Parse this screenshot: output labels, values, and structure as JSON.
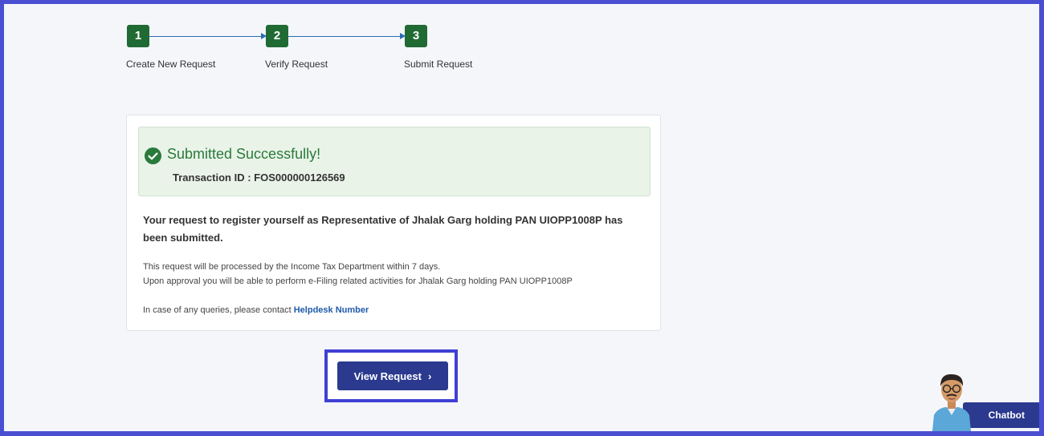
{
  "stepper": {
    "steps": [
      {
        "number": "1",
        "label": "Create New Request"
      },
      {
        "number": "2",
        "label": "Verify Request"
      },
      {
        "number": "3",
        "label": "Submit Request"
      }
    ]
  },
  "result": {
    "title": "Submitted Successfully!",
    "transaction_label": "Transaction ID :",
    "transaction_id": "FOS000000126569",
    "message": "Your request to register yourself as Representative of Jhalak Garg holding PAN UIOPP1008P has been submitted.",
    "note_processing": "This request will be processed by the Income Tax Department within 7 days.",
    "note_approval": "Upon approval you will be able to perform e-Filing related activities for Jhalak Garg holding PAN UIOPP1008P",
    "contact_text": "In case of any queries, please contact",
    "helpdesk_link": "Helpdesk Number"
  },
  "actions": {
    "view_request_label": "View Request"
  },
  "chatbot": {
    "label": "Chatbot"
  },
  "colors": {
    "step_green": "#1f6b33",
    "success_green": "#2a7a3b",
    "primary_button": "#2b3a8f",
    "highlight_border": "#3f3fd4"
  }
}
